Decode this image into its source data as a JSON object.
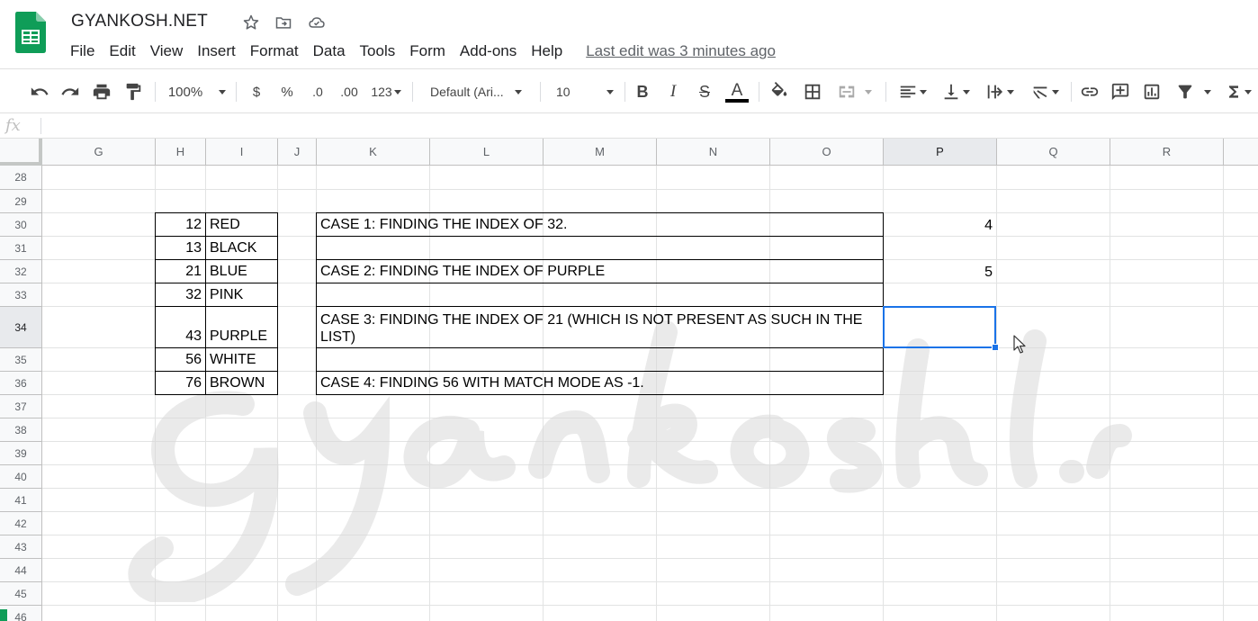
{
  "header": {
    "title": "GYANKOSH.NET",
    "menu": [
      "File",
      "Edit",
      "View",
      "Insert",
      "Format",
      "Data",
      "Tools",
      "Form",
      "Add-ons",
      "Help"
    ],
    "last_edit": "Last edit was 3 minutes ago"
  },
  "toolbar": {
    "zoom": "100%",
    "currency": "$",
    "percent": "%",
    "decrease_decimal": ".0",
    "increase_decimal": ".00",
    "more_formats": "123",
    "font": "Default (Ari...",
    "font_size": "10",
    "bold": "B",
    "italic": "I",
    "strikethrough": "S",
    "text_color": "A"
  },
  "formula_bar": {
    "fx": "fx",
    "value": ""
  },
  "columns": [
    "G",
    "H",
    "I",
    "J",
    "K",
    "L",
    "M",
    "N",
    "O",
    "P",
    "Q",
    "R"
  ],
  "selected_column": "P",
  "rows": [
    "28",
    "29",
    "30",
    "31",
    "32",
    "33",
    "34",
    "35",
    "36",
    "37",
    "38",
    "39",
    "40",
    "41",
    "42",
    "43",
    "44",
    "45",
    "46"
  ],
  "selected_row": "34",
  "table_h": [
    "12",
    "13",
    "21",
    "32",
    "",
    "43",
    "56",
    "76"
  ],
  "table_i": [
    "RED",
    "BLACK",
    "BLUE",
    "PINK",
    "PURPLE",
    "WHITE",
    "BROWN"
  ],
  "cases": {
    "case1": "CASE 1: FINDING THE INDEX OF 32.",
    "case2": "CASE 2: FINDING THE INDEX OF PURPLE",
    "case3": "CASE 3: FINDING THE INDEX OF 21 (WHICH IS NOT PRESENT AS SUCH IN THE LIST)",
    "case4": "CASE 4: FINDING 56 WITH MATCH MODE AS -1."
  },
  "results": {
    "r30": "4",
    "r32": "5"
  },
  "colors": {
    "accent": "#1a73e8",
    "sheets_green": "#0f9d58",
    "header_bg": "#f8f9fa"
  },
  "icons": [
    "sheets-logo-icon",
    "star-icon",
    "move-folder-icon",
    "cloud-status-icon",
    "undo-icon",
    "redo-icon",
    "print-icon",
    "paint-format-icon",
    "fill-color-icon",
    "borders-icon",
    "merge-cells-icon",
    "horizontal-align-icon",
    "vertical-align-icon",
    "text-wrap-icon",
    "text-rotate-icon",
    "link-icon",
    "comment-icon",
    "chart-icon",
    "filter-icon",
    "functions-icon"
  ]
}
